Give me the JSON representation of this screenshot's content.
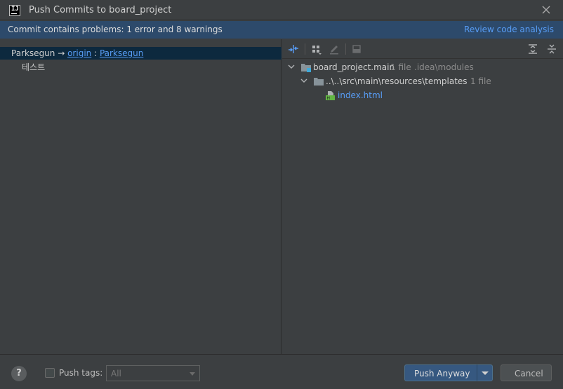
{
  "window": {
    "title": "Push Commits to board_project"
  },
  "banner": {
    "message": "Commit contains problems: 1 error and 8 warnings",
    "link": "Review code analysis"
  },
  "left": {
    "branch": {
      "local": "Parksegun",
      "arrow": " → ",
      "remote": "origin",
      "sep": " : ",
      "target": "Parksegun"
    },
    "commit": "테스트"
  },
  "tree": {
    "module": {
      "name": "board_project.main",
      "count": "1 file",
      "path": ".idea\\modules"
    },
    "folder": {
      "name": "..\\..\\src\\main\\resources\\templates",
      "count": "1 file"
    },
    "file": {
      "name": "index.html"
    }
  },
  "footer": {
    "help": "?",
    "push_tags_label": "Push tags:",
    "tags_value": "All",
    "push_button": "Push Anyway",
    "cancel_button": "Cancel"
  },
  "colors": {
    "accent": "#589df6",
    "banner": "#2d4a6b",
    "selected": "#0d293e",
    "primary_button": "#365880"
  }
}
